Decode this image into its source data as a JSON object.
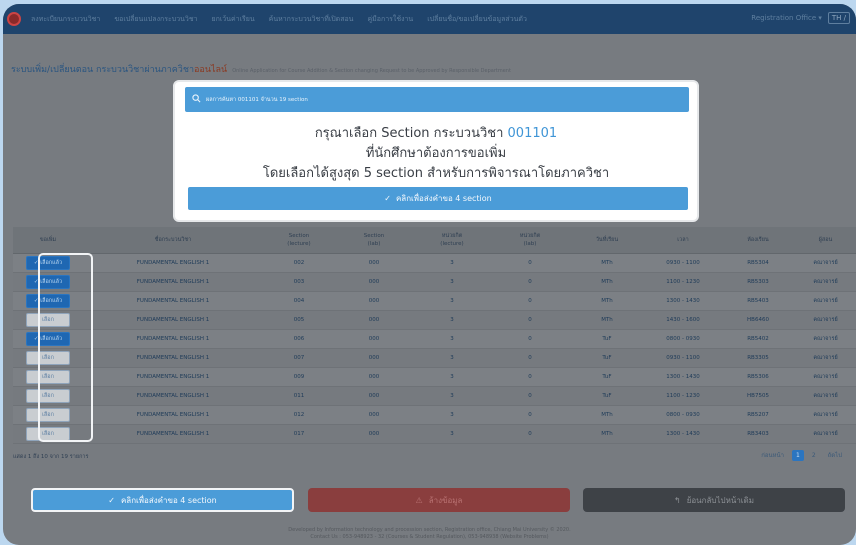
{
  "navbar": {
    "menu": [
      "ลงทะเบียนกระบวนวิชา",
      "ขอเปลี่ยนแปลงกระบวนวิชา",
      "ยกเว้นค่าเรียน",
      "ค้นหากระบวนวิชาที่เปิดสอน",
      "คู่มือการใช้งาน",
      "เปลี่ยนชื่อ/ขอเปลี่ยนข้อมูลส่วนตัว"
    ],
    "office": "Registration Office ▾",
    "lang": "TH /"
  },
  "page": {
    "title": "ระบบเพิ่ม/เปลี่ยนตอน กระบวนวิชาผ่านภาควิชา",
    "title_accent": "ออนไลน์",
    "subtitle": "Online Application for Course Addition & Section changing Request to be Approved by Responsible Department"
  },
  "modal": {
    "search_label": "ผลการค้นหา 001101 จำนวน 19 section",
    "line1_prefix": "กรุณาเลือก Section กระบวนวิชา",
    "course_code": "001101",
    "line2": "ที่นักศึกษาต้องการขอเพิ่ม",
    "line3": "โดยเลือกได้สูงสุด 5 section สำหรับการพิจารณาโดยภาควิชา",
    "submit_label": "คลิกเพื่อส่งคำขอ 4 section"
  },
  "table": {
    "headers": [
      [
        "ขอเพิ่ม"
      ],
      [
        "ชื่อกระบวนวิชา"
      ],
      [
        "Section",
        "(lecture)"
      ],
      [
        "Section",
        "(lab)"
      ],
      [
        "หน่วยกิต",
        "(lecture)"
      ],
      [
        "หน่วยกิต",
        "(lab)"
      ],
      [
        "วันที่เรียน"
      ],
      [
        "เวลา"
      ],
      [
        "ห้องเรียน"
      ],
      [
        "ผู้สอน"
      ]
    ],
    "rows": [
      {
        "pick": "✓ เลือกแล้ว",
        "selected": true,
        "name": "FUNDAMENTAL ENGLISH 1",
        "sec_lec": "002",
        "sec_lab": "000",
        "cr_lec": "3",
        "cr_lab": "0",
        "days": "MTh",
        "time": "0930 - 1100",
        "room": "RB5304",
        "teacher": "คณาจารย์"
      },
      {
        "pick": "✓ เลือกแล้ว",
        "selected": true,
        "name": "FUNDAMENTAL ENGLISH 1",
        "sec_lec": "003",
        "sec_lab": "000",
        "cr_lec": "3",
        "cr_lab": "0",
        "days": "MTh",
        "time": "1100 - 1230",
        "room": "RB5303",
        "teacher": "คณาจารย์"
      },
      {
        "pick": "✓ เลือกแล้ว",
        "selected": true,
        "name": "FUNDAMENTAL ENGLISH 1",
        "sec_lec": "004",
        "sec_lab": "000",
        "cr_lec": "3",
        "cr_lab": "0",
        "days": "MTh",
        "time": "1300 - 1430",
        "room": "RB5403",
        "teacher": "คณาจารย์"
      },
      {
        "pick": "เลือก",
        "selected": false,
        "name": "FUNDAMENTAL ENGLISH 1",
        "sec_lec": "005",
        "sec_lab": "000",
        "cr_lec": "3",
        "cr_lab": "0",
        "days": "MTh",
        "time": "1430 - 1600",
        "room": "HB6460",
        "teacher": "คณาจารย์"
      },
      {
        "pick": "✓ เลือกแล้ว",
        "selected": true,
        "name": "FUNDAMENTAL ENGLISH 1",
        "sec_lec": "006",
        "sec_lab": "000",
        "cr_lec": "3",
        "cr_lab": "0",
        "days": "TuF",
        "time": "0800 - 0930",
        "room": "RB5402",
        "teacher": "คณาจารย์"
      },
      {
        "pick": "เลือก",
        "selected": false,
        "name": "FUNDAMENTAL ENGLISH 1",
        "sec_lec": "007",
        "sec_lab": "000",
        "cr_lec": "3",
        "cr_lab": "0",
        "days": "TuF",
        "time": "0930 - 1100",
        "room": "RB3305",
        "teacher": "คณาจารย์"
      },
      {
        "pick": "เลือก",
        "selected": false,
        "name": "FUNDAMENTAL ENGLISH 1",
        "sec_lec": "009",
        "sec_lab": "000",
        "cr_lec": "3",
        "cr_lab": "0",
        "days": "TuF",
        "time": "1300 - 1430",
        "room": "RB5306",
        "teacher": "คณาจารย์"
      },
      {
        "pick": "เลือก",
        "selected": false,
        "name": "FUNDAMENTAL ENGLISH 1",
        "sec_lec": "011",
        "sec_lab": "000",
        "cr_lec": "3",
        "cr_lab": "0",
        "days": "TuF",
        "time": "1100 - 1230",
        "room": "HB7505",
        "teacher": "คณาจารย์"
      },
      {
        "pick": "เลือก",
        "selected": false,
        "name": "FUNDAMENTAL ENGLISH 1",
        "sec_lec": "012",
        "sec_lab": "000",
        "cr_lec": "3",
        "cr_lab": "0",
        "days": "MTh",
        "time": "0800 - 0930",
        "room": "RB5207",
        "teacher": "คณาจารย์"
      },
      {
        "pick": "เลือก",
        "selected": false,
        "name": "FUNDAMENTAL ENGLISH 1",
        "sec_lec": "017",
        "sec_lab": "000",
        "cr_lec": "3",
        "cr_lab": "0",
        "days": "MTh",
        "time": "1300 - 1430",
        "room": "RB3403",
        "teacher": "คณาจารย์"
      }
    ]
  },
  "rows_info": "แสดง 1 ถึง 10 จาก 19 รายการ",
  "pagination": {
    "prev": "ก่อนหน้า",
    "pages": [
      "1",
      "2"
    ],
    "next": "ถัดไป"
  },
  "actions": {
    "submit_label": "คลิกเพื่อส่งคำขอ 4 section",
    "clear_label": "ล้างข้อมูล",
    "back_label": "ย้อนกลับไปหน้าเดิม"
  },
  "credit": {
    "line1": "Developed by Information technology and procession section, Registration office, Chiang Mai University © 2020.",
    "line2": "Contact Us : 053-948923 - 32 (Courses & Student Regulation), 053-948938 (Website Problems)"
  }
}
